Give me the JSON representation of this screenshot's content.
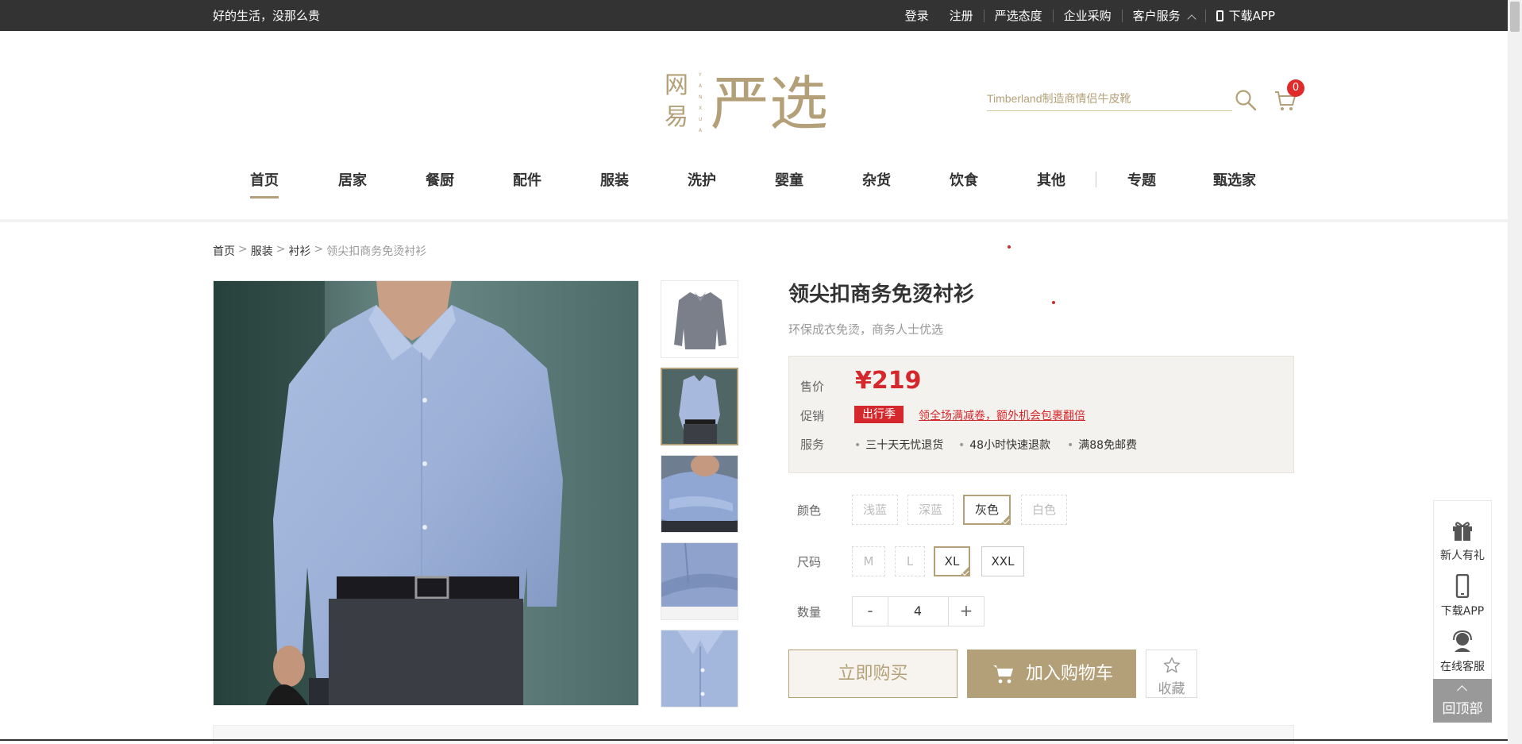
{
  "topbar": {
    "slogan": "好的生活，没那么贵",
    "links": [
      "登录",
      "注册",
      "严选态度",
      "企业采购",
      "客户服务",
      "下载APP"
    ]
  },
  "header": {
    "logo_text": "网易严选",
    "search_placeholder": "Timberland制造商情侣牛皮靴",
    "cart_count": "0"
  },
  "nav": {
    "items": [
      "首页",
      "居家",
      "餐厨",
      "配件",
      "服装",
      "洗护",
      "婴童",
      "杂货",
      "饮食",
      "其他",
      "专题",
      "甄选家"
    ],
    "active": "首页"
  },
  "breadcrumb": {
    "items": [
      "首页",
      "服装",
      "衬衫"
    ],
    "sep": ">",
    "current": "领尖扣商务免烫衬衫"
  },
  "product": {
    "title": "领尖扣商务免烫衬衫",
    "subtitle": "环保成衣免烫，商务人士优选",
    "price_label": "售价",
    "price": "¥219",
    "promo_label": "促销",
    "promo_tag": "出行季",
    "promo_text": "领全场满减卷，额外机会包裹翻倍",
    "service_label": "服务",
    "services": [
      "三十天无忧退货",
      "48小时快速退款",
      "满88免邮费"
    ],
    "color_label": "颜色",
    "colors": [
      "浅蓝",
      "深蓝",
      "灰色",
      "白色"
    ],
    "color_selected": "灰色",
    "size_label": "尺码",
    "sizes": [
      "M",
      "L",
      "XL",
      "XXL"
    ],
    "size_selected": "XL",
    "qty_label": "数量",
    "qty": "4",
    "qty_minus": "-",
    "qty_plus": "+",
    "buy_now": "立即购买",
    "add_cart": "加入购物车",
    "favorite": "收藏"
  },
  "sidebar": {
    "items": [
      "新人有礼",
      "下载APP",
      "在线客服"
    ],
    "to_top": "回顶部"
  },
  "colors": {
    "topbar_bg": "#333333",
    "accent_gold": "#b4a078",
    "price_red": "#d4282d"
  }
}
